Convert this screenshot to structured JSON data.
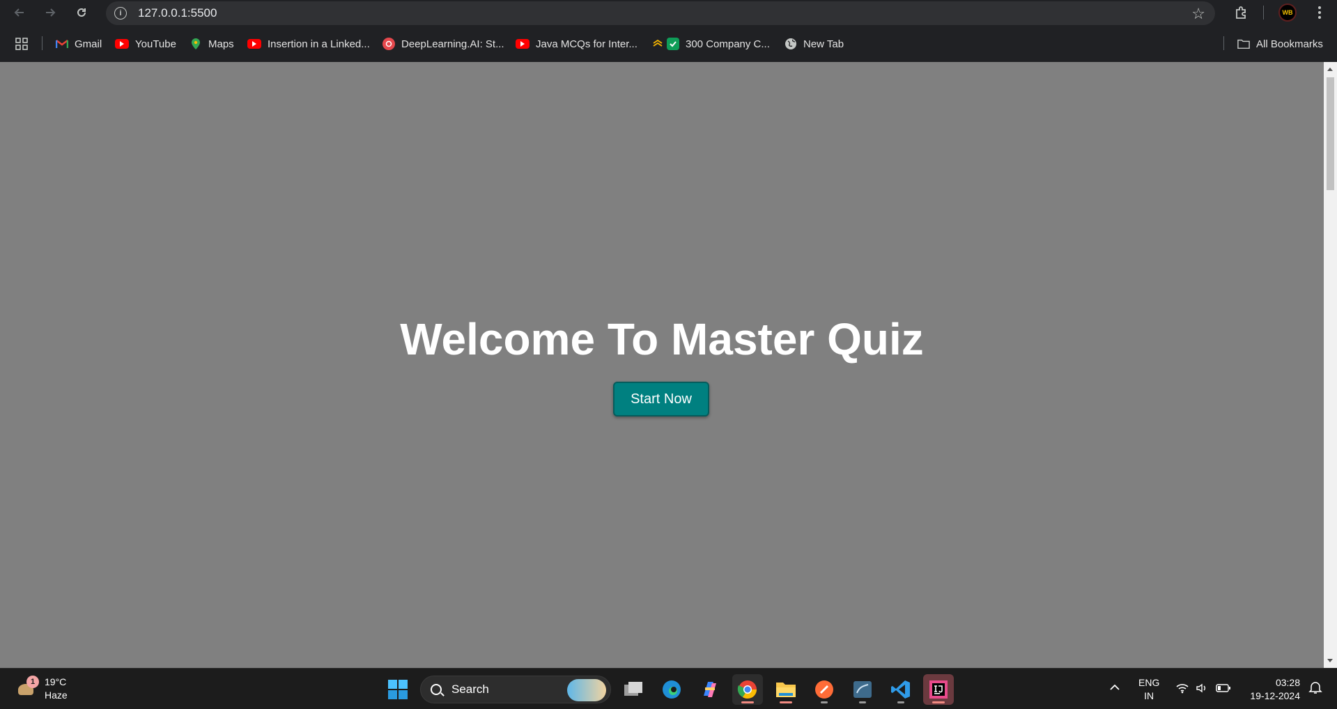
{
  "browser": {
    "url": "127.0.0.1:5500",
    "all_bookmarks_label": "All Bookmarks",
    "profile_initials": "WB",
    "bookmarks": [
      {
        "label": "Gmail",
        "icon": "gmail-icon"
      },
      {
        "label": "YouTube",
        "icon": "youtube-icon"
      },
      {
        "label": "Maps",
        "icon": "maps-icon"
      },
      {
        "label": "Insertion in a Linked...",
        "icon": "youtube-icon"
      },
      {
        "label": "DeepLearning.AI: St...",
        "icon": "deeplearning-icon"
      },
      {
        "label": "Java MCQs for Inter...",
        "icon": "youtube-icon"
      },
      {
        "label": "300 Company C...",
        "icon": "checkbox-icon"
      },
      {
        "label": "New Tab",
        "icon": "globe-icon"
      }
    ]
  },
  "page": {
    "title": "Welcome To Master Quiz",
    "start_button": "Start Now",
    "background": "#808080",
    "button_color": "#008080"
  },
  "taskbar": {
    "weather_temp": "19°C",
    "weather_desc": "Haze",
    "weather_badge": "1",
    "search_label": "Search",
    "lang_top": "ENG",
    "lang_bottom": "IN",
    "time": "03:28",
    "date": "19-12-2024"
  }
}
